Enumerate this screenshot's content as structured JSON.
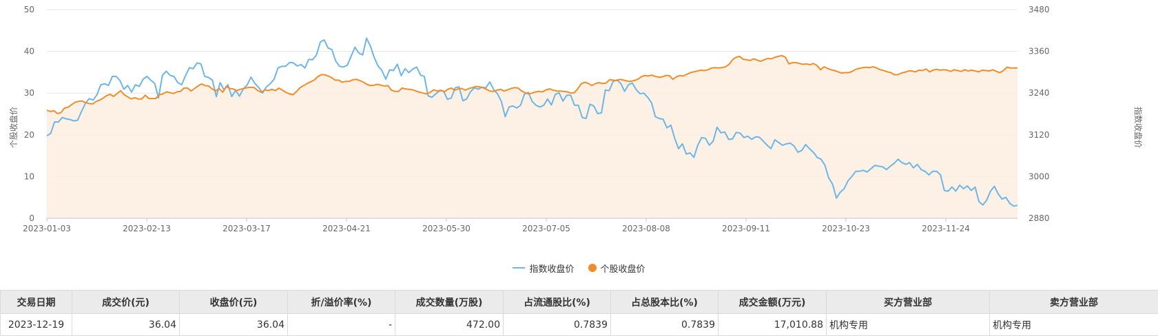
{
  "chart_data": {
    "type": "line",
    "ylabel_left": "个股收盘价",
    "ylabel_right": "指数收盘价",
    "ylim_left": [
      0,
      50
    ],
    "ylim_right": [
      2880,
      3480
    ],
    "yticks_left": [
      "0",
      "10",
      "20",
      "30",
      "40",
      "50"
    ],
    "yticks_right": [
      "2880",
      "3000",
      "3120",
      "3240",
      "3360",
      "3480"
    ],
    "xticks": [
      "2023-01-03",
      "2023-02-13",
      "2023-03-17",
      "2023-04-21",
      "2023-05-30",
      "2023-07-05",
      "2023-08-08",
      "2023-09-11",
      "2023-10-23",
      "2023-11-24"
    ],
    "grid": true,
    "legend_position": "bottom-center",
    "colors": {
      "index": "#6cb5e8",
      "stock": "#f28c28",
      "stock_fill": "#fdeee2"
    },
    "series": [
      {
        "name": "指数收盘价",
        "axis": "right",
        "values": [
          3117,
          3124,
          3157,
          3157,
          3170,
          3166,
          3164,
          3160,
          3162,
          3187,
          3210,
          3224,
          3220,
          3235,
          3264,
          3267,
          3262,
          3288,
          3288,
          3276,
          3251,
          3262,
          3243,
          3264,
          3259,
          3280,
          3288,
          3277,
          3268,
          3226,
          3291,
          3303,
          3291,
          3288,
          3270,
          3264,
          3290,
          3313,
          3310,
          3327,
          3324,
          3288,
          3285,
          3277,
          3230,
          3270,
          3249,
          3264,
          3230,
          3248,
          3231,
          3252,
          3263,
          3286,
          3268,
          3256,
          3240,
          3258,
          3267,
          3280,
          3312,
          3317,
          3317,
          3328,
          3327,
          3318,
          3322,
          3312,
          3337,
          3336,
          3350,
          3387,
          3393,
          3370,
          3365,
          3332,
          3317,
          3315,
          3320,
          3346,
          3372,
          3355,
          3350,
          3398,
          3375,
          3342,
          3318,
          3305,
          3280,
          3307,
          3305,
          3323,
          3290,
          3310,
          3299,
          3309,
          3315,
          3292,
          3288,
          3232,
          3228,
          3238,
          3247,
          3246,
          3222,
          3226,
          3255,
          3258,
          3218,
          3223,
          3244,
          3255,
          3251,
          3257,
          3255,
          3272,
          3250,
          3238,
          3216,
          3172,
          3200,
          3203,
          3197,
          3205,
          3237,
          3242,
          3216,
          3205,
          3200,
          3205,
          3223,
          3206,
          3236,
          3241,
          3217,
          3234,
          3234,
          3205,
          3205,
          3170,
          3167,
          3208,
          3203,
          3181,
          3183,
          3249,
          3247,
          3273,
          3278,
          3268,
          3245,
          3264,
          3269,
          3250,
          3238,
          3240,
          3228,
          3212,
          3172,
          3167,
          3165,
          3140,
          3148,
          3110,
          3080,
          3094,
          3065,
          3068,
          3055,
          3090,
          3112,
          3110,
          3090,
          3102,
          3142,
          3126,
          3128,
          3107,
          3108,
          3127,
          3125,
          3112,
          3116,
          3107,
          3114,
          3113,
          3102,
          3090,
          3080,
          3106,
          3098,
          3090,
          3094,
          3096,
          3088,
          3070,
          3075,
          3092,
          3080,
          3070,
          3055,
          3050,
          3033,
          2996,
          2978,
          2938,
          2955,
          2965,
          2988,
          3000,
          3015,
          3015,
          3018,
          3013,
          3023,
          3032,
          3030,
          3028,
          3020,
          3030,
          3038,
          3050,
          3040,
          3035,
          3040,
          3025,
          3035,
          3020,
          3015,
          3005,
          3015,
          3015,
          3005,
          2960,
          2958,
          2970,
          2958,
          2975,
          2965,
          2973,
          2960,
          2970,
          2928,
          2918,
          2932,
          2958,
          2972,
          2950,
          2935,
          2940,
          2923,
          2915,
          2917
        ]
      },
      {
        "name": "个股收盘价",
        "axis": "left",
        "values": [
          25.9,
          25.6,
          25.8,
          25.1,
          25.3,
          26.4,
          26.6,
          27.2,
          27.8,
          28.0,
          28.1,
          27.7,
          27.5,
          27.4,
          28.0,
          28.3,
          28.8,
          29.4,
          29.7,
          29.2,
          29.9,
          30.6,
          29.6,
          29.1,
          28.6,
          28.9,
          28.6,
          28.6,
          29.5,
          28.7,
          28.7,
          28.7,
          29.6,
          29.8,
          30.3,
          30.1,
          29.9,
          30.3,
          30.4,
          31.2,
          31.2,
          30.5,
          31.1,
          31.7,
          32.2,
          31.8,
          31.7,
          31.0,
          30.5,
          31.1,
          30.2,
          31.6,
          31.1,
          31.0,
          30.6,
          30.9,
          31.1,
          31.3,
          31.4,
          31.3,
          30.6,
          30.2,
          30.8,
          30.6,
          30.9,
          30.6,
          31.2,
          30.7,
          30.2,
          29.8,
          29.6,
          30.4,
          31.3,
          31.8,
          32.3,
          32.7,
          33.1,
          33.9,
          34.4,
          34.4,
          34.1,
          33.7,
          33.1,
          33.1,
          32.6,
          32.8,
          32.8,
          33.2,
          33.3,
          33.0,
          32.6,
          32.1,
          31.8,
          31.9,
          32.1,
          31.9,
          31.7,
          31.8,
          30.7,
          30.4,
          30.4,
          31.2,
          31.0,
          30.9,
          30.8,
          30.5,
          30.2,
          30.0,
          29.8,
          30.2,
          30.8,
          30.5,
          30.7,
          30.3,
          30.9,
          31.2,
          30.7,
          31.0,
          31.1,
          30.7,
          31.1,
          31.3,
          31.6,
          31.5,
          31.3,
          30.9,
          30.5,
          30.4,
          30.7,
          30.9,
          30.5,
          30.8,
          31.1,
          31.3,
          31.2,
          30.5,
          30.1,
          29.8,
          30.0,
          30.3,
          30.4,
          30.3,
          30.8,
          31.0,
          30.7,
          30.5,
          30.5,
          30.4,
          30.3,
          30.0,
          30.1,
          31.1,
          32.3,
          32.6,
          32.3,
          31.8,
          32.3,
          32.5,
          32.3,
          32.4,
          33.2,
          33.1,
          33.0,
          33.3,
          33.1,
          32.9,
          32.8,
          33.0,
          33.3,
          33.9,
          34.2,
          34.1,
          34.3,
          34.0,
          33.8,
          33.9,
          34.2,
          34.2,
          33.3,
          33.9,
          34.2,
          34.1,
          34.5,
          34.9,
          35.1,
          35.3,
          35.5,
          35.4,
          35.6,
          36.0,
          36.1,
          36.0,
          36.1,
          36.3,
          36.9,
          38.0,
          38.6,
          38.8,
          38.1,
          38.0,
          37.8,
          38.2,
          37.9,
          37.6,
          38.0,
          38.3,
          38.2,
          38.6,
          38.8,
          39.0,
          38.6,
          37.0,
          37.3,
          37.3,
          37.1,
          36.9,
          37.0,
          36.8,
          37.1,
          36.6,
          35.6,
          36.3,
          35.9,
          35.6,
          35.4,
          35.1,
          34.8,
          34.9,
          34.9,
          35.2,
          35.7,
          35.9,
          36.1,
          36.2,
          36.1,
          36.3,
          36.0,
          35.6,
          35.4,
          35.1,
          34.9,
          34.4,
          34.4,
          34.8,
          35.0,
          35.3,
          35.3,
          35.1,
          35.5,
          35.4,
          35.8,
          35.1,
          35.5,
          35.7,
          35.5,
          35.6,
          35.5,
          35.2,
          35.6,
          35.4,
          35.2,
          35.6,
          35.3,
          35.5,
          35.3,
          35.1,
          35.5,
          35.4,
          35.3,
          35.6,
          35.2,
          34.9,
          35.4,
          36.2,
          36.0,
          36.0,
          36.04
        ]
      }
    ]
  },
  "legend": {
    "index_label": "指数收盘价",
    "stock_label": "个股收盘价"
  },
  "table": {
    "headers": [
      "交易日期",
      "成交价(元)",
      "收盘价(元)",
      "折/溢价率(%)",
      "成交数量(万股)",
      "占流通股比(%)",
      "占总股本比(%)",
      "成交金额(万元)",
      "买方营业部",
      "卖方营业部"
    ],
    "rows": [
      [
        "2023-12-19",
        "36.04",
        "36.04",
        "-",
        "472.00",
        "0.7839",
        "0.7839",
        "17,010.88",
        "机构专用",
        "机构专用"
      ]
    ]
  }
}
